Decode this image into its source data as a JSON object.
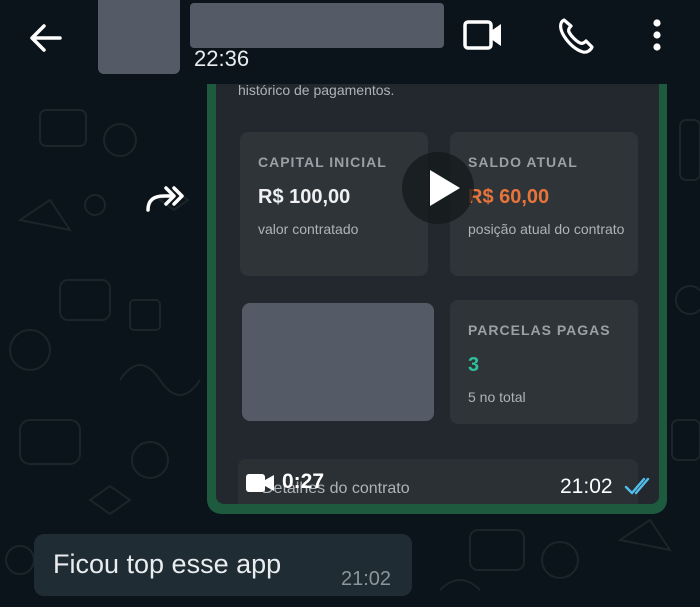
{
  "header": {
    "last_seen": "22:36",
    "icons": [
      "back-arrow-icon",
      "video-call-icon",
      "phone-call-icon",
      "more-options-icon"
    ]
  },
  "video_message": {
    "forwarded_icon": "forward-icon",
    "content": {
      "history_text": "histórico de pagamentos.",
      "cards": [
        {
          "title": "CAPITAL INICIAL",
          "value": "R$ 100,00",
          "subtitle": "valor contratado",
          "value_color": "#eef0f1"
        },
        {
          "title": "SALDO ATUAL",
          "value": "R$ 60,00",
          "subtitle": "posição atual do contrato",
          "value_color": "#e8743b"
        },
        {
          "title": "PARCELAS PAGAS",
          "value": "3",
          "subtitle": "5 no total",
          "value_color": "#2fbf9b"
        }
      ],
      "footer_text": "Detalhes do contrato"
    },
    "duration": "0:27",
    "time": "21:02",
    "read_status": "read-double-check-icon"
  },
  "text_message": {
    "text": "Ficou top esse app",
    "time": "21:02"
  },
  "colors": {
    "background": "#0b141a",
    "outgoing_bubble": "#1d5a3e",
    "incoming_bubble": "#1f2c34",
    "read_ticks": "#53bdeb"
  }
}
